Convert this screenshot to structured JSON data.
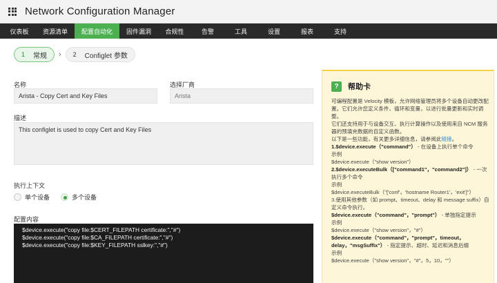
{
  "app": {
    "title": "Network Configuration Manager"
  },
  "nav": {
    "items": [
      {
        "label": "仪表板"
      },
      {
        "label": "资源清单"
      },
      {
        "label": "配置自动化"
      },
      {
        "label": "固件漏洞"
      },
      {
        "label": "合规性"
      },
      {
        "label": "告警"
      },
      {
        "label": "工具"
      },
      {
        "label": "设置"
      },
      {
        "label": "报表"
      },
      {
        "label": "支持"
      }
    ],
    "active_index": 2
  },
  "wizard": {
    "steps": [
      {
        "num": "1",
        "label": "常规"
      },
      {
        "num": "2",
        "label": "Configlet 参数"
      }
    ],
    "chevron": "›"
  },
  "form": {
    "name_label": "名称",
    "name_value": "Arista - Copy Cert and Key Files",
    "vendor_label": "选择厂商",
    "vendor_value": "Arista",
    "desc_label": "描述",
    "desc_value": "This configlet is used to copy Cert and Key Files",
    "context_label": "执行上下文",
    "radio_single": "单个设备",
    "radio_multi": "多个设备",
    "radio_selected": "多个设备",
    "content_label": "配置内容",
    "content_lines": [
      "$device.execute(\"copy file:$CERT_FILEPATH certificate:\",\"#\")",
      "$device.execute(\"copy file:$CA_FILEPATH certificate:\",\"#\")",
      "$device.execute(\"copy file:$KEY_FILEPATH sslkey:\",\"#\")"
    ]
  },
  "help": {
    "icon": "?",
    "title": "帮助卡",
    "p1": "可编程配置是 Velocity 模板，允许网络管理员将多个设备自动更改配置。它们允许您定义条件、循环和变量，以进行批量更新和实时调整。",
    "p2": "它们还支持用于与设备交互、执行计算操作以及使用来自 NCM 服务器的预填充数据的自定义函数。",
    "p3_prefix": "以下是一些功能，有关更多详细信息，请参阅此",
    "p3_link": "链接",
    "p3_suffix": "。",
    "f1_bold": "1.$device.execute（\"command\"）",
    "f1_text": "- 在设备上执行单个命令",
    "example": "示例",
    "f1_example": "$device.execute（\"show version\"）",
    "f2_bold": "2.$device.executeBulk（[\"command1\"，\"command2\"]）",
    "f2_text": "- 一次执行多个命令",
    "f2_example": "$device.executeBulk（\"['conf'，'hostname Router1'，'exit']\"）",
    "f3_text": "3.使用其他参数（如 prompt、timeout、delay 和 message suffix）自定义命令执行。",
    "f3a_bold": "$device.execute（\"command\"，\"prompt\"）",
    "f3a_text": "- 单独指定提示",
    "f3a_example": "$device.execute（\"show version\"，\"#\"）",
    "f3b_bold": "$device.execute（\"command\"，\"prompt\"，timeout，delay，\"msgSuffix\"）",
    "f3b_text": "- 指定提示、超时、延迟和消息后缀",
    "f3b_example": "$device.execute（\"show version\"，\"#\"，5，10，\"\"）"
  },
  "colors": {
    "accent": "#4caf50",
    "nav_bg": "#2a2a2a",
    "help_bg": "#fdf6d8",
    "help_border": "#f5d24a",
    "code_bg": "#1c1c1c",
    "link": "#2d8ad6"
  }
}
